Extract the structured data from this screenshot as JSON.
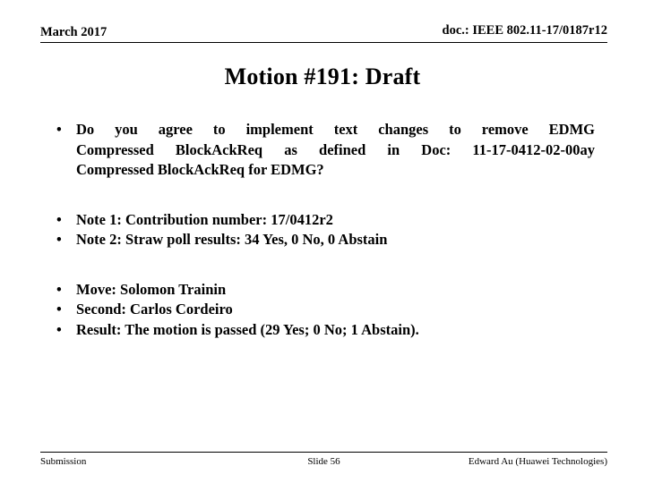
{
  "slide": {
    "header": {
      "date": "March 2017",
      "doc_reference": "doc.: IEEE 802.11-17/0187r12"
    },
    "title": "Motion #191:  Draft",
    "groups": [
      {
        "name": "motion-question",
        "bullets": [
          {
            "bullet": "•",
            "lines": [
              "Do you agree to implement text changes to remove EDMG",
              "Compressed BlockAckReq as defined in Doc: 11-17-0412-02-00ay",
              "Compressed BlockAckReq for EDMG?"
            ]
          }
        ]
      },
      {
        "name": "notes",
        "bullets": [
          {
            "bullet": "•",
            "lines": [
              "Note 1:  Contribution number:  17/0412r2"
            ]
          },
          {
            "bullet": "•",
            "lines": [
              "Note 2:  Straw poll results:  34 Yes, 0 No, 0 Abstain"
            ]
          }
        ]
      },
      {
        "name": "vote-outcome",
        "bullets": [
          {
            "bullet": "•",
            "lines": [
              "Move:  Solomon Trainin"
            ]
          },
          {
            "bullet": "•",
            "lines": [
              "Second:  Carlos Cordeiro"
            ]
          },
          {
            "bullet": "•",
            "lines": [
              "Result:  The motion is passed (29 Yes; 0 No; 1 Abstain)."
            ]
          }
        ]
      }
    ],
    "footer": {
      "left": "Submission",
      "center": "Slide 56",
      "right": "Edward Au (Huawei Technologies)"
    },
    "colors": {
      "text": "#000000",
      "background": "#ffffff",
      "rule": "#000000"
    }
  }
}
